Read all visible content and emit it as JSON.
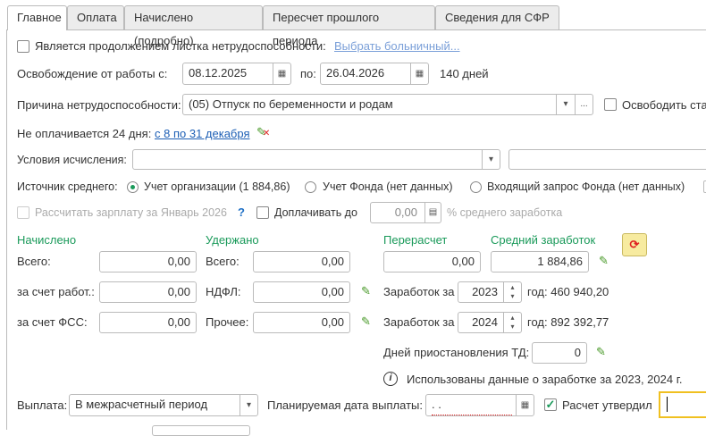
{
  "tabs": [
    "Главное",
    "Оплата",
    "Начислено (подробно)",
    "Пересчет прошлого периода",
    "Сведения для СФР"
  ],
  "continuation": {
    "label": "Является продолжением листка нетрудоспособности:",
    "link": "Выбрать больничный..."
  },
  "release": {
    "label": "Освобождение от работы с:",
    "from": "08.12.2025",
    "to_label": "по:",
    "to": "26.04.2026",
    "days": "140 дней"
  },
  "reason": {
    "label": "Причина нетрудоспособности:",
    "value": "(05) Отпуск по беременности и родам",
    "more": "...",
    "free_label": "Освободить ста"
  },
  "unpaid": {
    "label": "Не оплачивается 24 дня:",
    "link": "с 8 по 31 декабря"
  },
  "conditions": {
    "label": "Условия исчисления:",
    "value": "",
    "value2": ""
  },
  "source": {
    "label": "Источник среднего:",
    "options": [
      "Учет организации (1 884,86)",
      "Учет Фонда (нет данных)",
      "Входящий запрос Фонда (нет данных)"
    ],
    "selected": 0
  },
  "calc_salary": {
    "label": "Рассчитать зарплату за Январь 2026",
    "help": "?"
  },
  "topup": {
    "label": "Доплачивать до",
    "value": "0,00",
    "suffix": "% среднего заработка"
  },
  "accrued": {
    "title": "Начислено",
    "total_label": "Всего:",
    "total": "0,00",
    "employer_label": "за счет работ.:",
    "employer": "0,00",
    "fss_label": "за счет ФСС:",
    "fss": "0,00"
  },
  "withheld": {
    "title": "Удержано",
    "total_label": "Всего:",
    "total": "0,00",
    "ndfl_label": "НДФЛ:",
    "ndfl": "0,00",
    "other_label": "Прочее:",
    "other": "0,00"
  },
  "recalc": {
    "title": "Перерасчет",
    "value": "0,00"
  },
  "avg": {
    "title": "Средний заработок",
    "value": "1 884,86"
  },
  "earnings": [
    {
      "label": "Заработок за",
      "year": "2023",
      "suffix": "год: 460 940,20"
    },
    {
      "label": "Заработок за",
      "year": "2024",
      "suffix": "год: 892 392,77"
    }
  ],
  "suspension": {
    "label": "Дней приостановления ТД:",
    "value": "0"
  },
  "info": "Использованы данные о заработке за  2023,  2024 г.",
  "payment": {
    "label": "Выплата:",
    "value": "В межрасчетный период",
    "date_label": "Планируемая дата выплаты:",
    "date": " .  . ",
    "approved_label": "Расчет утвердил",
    "approved_value": ""
  }
}
